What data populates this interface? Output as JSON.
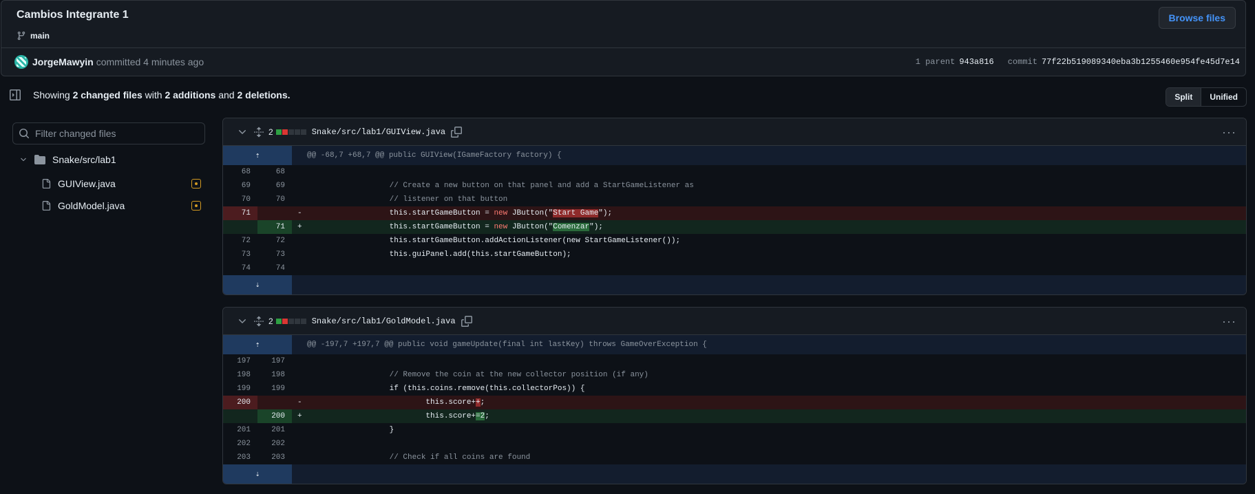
{
  "commit": {
    "title": "Cambios Integrante 1",
    "branch": "main",
    "browse_label": "Browse files",
    "author": "JorgeMawyin",
    "action": "committed 4 minutes ago",
    "parent_label": "1 parent",
    "parent_sha": "943a816",
    "commit_label": "commit",
    "commit_sha": "77f22b519089340eba3b1255460e954fe45d7e14"
  },
  "summary": {
    "showing": "Showing",
    "files": "2 changed files",
    "with": "with",
    "additions": "2 additions",
    "and": "and",
    "deletions": "2 deletions."
  },
  "view_toggle": {
    "split": "Split",
    "unified": "Unified"
  },
  "filter": {
    "placeholder": "Filter changed files"
  },
  "tree": {
    "folder": "Snake/src/lab1",
    "files": [
      "GUIView.java",
      "GoldModel.java"
    ]
  },
  "diffs": [
    {
      "count": "2",
      "path": "Snake/src/lab1/GUIView.java",
      "hunk": "@@ -68,7 +68,7 @@ public GUIView(IGameFactory factory) {",
      "lines": [
        {
          "old": "68",
          "new": "68",
          "sign": "",
          "code": ""
        },
        {
          "old": "69",
          "new": "69",
          "sign": "",
          "code": "                // Create a new button on that panel and add a StartGameListener as"
        },
        {
          "old": "70",
          "new": "70",
          "sign": "",
          "code": "                // listener on that button"
        },
        {
          "old": "71",
          "new": "",
          "sign": "-",
          "code_pre": "                this.startGameButton = ",
          "code_kw": "new",
          "code_mid": " JButton(\"",
          "code_hl": "Start Game",
          "code_post": "\");"
        },
        {
          "old": "",
          "new": "71",
          "sign": "+",
          "code_pre": "                this.startGameButton = ",
          "code_kw": "new",
          "code_mid": " JButton(\"",
          "code_hl": "Comenzar",
          "code_post": "\");"
        },
        {
          "old": "72",
          "new": "72",
          "sign": "",
          "code": "                this.startGameButton.addActionListener(new StartGameListener());"
        },
        {
          "old": "73",
          "new": "73",
          "sign": "",
          "code": "                this.guiPanel.add(this.startGameButton);"
        },
        {
          "old": "74",
          "new": "74",
          "sign": "",
          "code": ""
        }
      ]
    },
    {
      "count": "2",
      "path": "Snake/src/lab1/GoldModel.java",
      "hunk": "@@ -197,7 +197,7 @@ public void gameUpdate(final int lastKey) throws GameOverException {",
      "lines": [
        {
          "old": "197",
          "new": "197",
          "sign": "",
          "code": ""
        },
        {
          "old": "198",
          "new": "198",
          "sign": "",
          "code": "                // Remove the coin at the new collector position (if any)"
        },
        {
          "old": "199",
          "new": "199",
          "sign": "",
          "code": "                if (this.coins.remove(this.collectorPos)) {"
        },
        {
          "old": "200",
          "new": "",
          "sign": "-",
          "code_pre": "                        this.score+",
          "code_hl": "+",
          "code_post": ";"
        },
        {
          "old": "",
          "new": "200",
          "sign": "+",
          "code_pre": "                        this.score+",
          "code_hl": "=2",
          "code_post": ";"
        },
        {
          "old": "201",
          "new": "201",
          "sign": "",
          "code": "                }"
        },
        {
          "old": "202",
          "new": "202",
          "sign": "",
          "code": ""
        },
        {
          "old": "203",
          "new": "203",
          "sign": "",
          "code": "                // Check if all coins are found"
        }
      ]
    }
  ],
  "colors": {
    "accent": "#4493f8",
    "added": "#2ea043",
    "removed": "#da3633",
    "modified": "#d29922"
  }
}
